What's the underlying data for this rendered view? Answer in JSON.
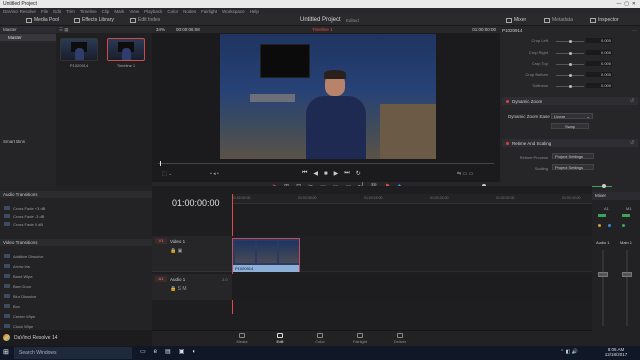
{
  "window": {
    "title": "Untitled Project"
  },
  "menu": [
    "DaVinci Resolve",
    "File",
    "Edit",
    "Trim",
    "Timeline",
    "Clip",
    "Mark",
    "View",
    "Playback",
    "Color",
    "Nodes",
    "Fairlight",
    "Workspace",
    "Help"
  ],
  "toolbar": {
    "media_pool": "Media Pool",
    "effects_library": "Effects Library",
    "edit_index": "Edit Index",
    "project_title": "Untitled Project",
    "project_state": "Edited",
    "mixer": "Mixer",
    "metadata": "Metadata",
    "inspector": "Inspector"
  },
  "bins": {
    "header": "Master",
    "items": [
      "Master"
    ],
    "smart_bins": "Smart Bins"
  },
  "media_pool": {
    "clips": [
      {
        "name": "P1020914"
      },
      {
        "name": "Timeline 1"
      }
    ]
  },
  "viewer": {
    "zoom": "34%",
    "source_tc": "00:00:06:08",
    "timeline_name": "Timeline 1",
    "record_tc": "01:00:00:00"
  },
  "inspector": {
    "clip_name": "P1020914",
    "crop": [
      {
        "label": "Crop Left",
        "value": "0.000"
      },
      {
        "label": "Crop Right",
        "value": "0.000"
      },
      {
        "label": "Crop Top",
        "value": "0.000"
      },
      {
        "label": "Crop Bottom",
        "value": "0.000"
      },
      {
        "label": "Softness",
        "value": "0.000"
      }
    ],
    "dynamic_zoom": {
      "title": "Dynamic Zoom",
      "ease_label": "Dynamic Zoom Ease",
      "ease_value": "Linear",
      "swap": "Swap"
    },
    "retime": {
      "title": "Retime And Scaling",
      "retime_process_label": "Retime Process",
      "retime_process_value": "Project Settings",
      "scaling_label": "Scaling",
      "scaling_value": "Project Settings"
    }
  },
  "effects": {
    "audio_header": "Audio Transitions",
    "audio_items": [
      "Cross Fade +3 dB",
      "Cross Fade -3 dB",
      "Cross Fade 0 dB"
    ],
    "video_header": "Video Transitions",
    "video_items": [
      "Additive Dissolve",
      "Arrow Iris",
      "Band Wipe",
      "Barn Door",
      "Blur Dissolve",
      "Box",
      "Center Wipe",
      "Clock Wipe"
    ]
  },
  "timeline": {
    "timecode": "01:00:00:00",
    "ruler": [
      "01:00:00:00",
      "01:00:08:00",
      "01:00:16:00",
      "01:00:24:00",
      "01:00:32:00",
      "01:00:40:00",
      "01:00:48:00"
    ],
    "video_track": {
      "id": "V1",
      "name": "Video 1"
    },
    "audio_track": {
      "id": "A1",
      "name": "Audio 1",
      "format": "2.0"
    },
    "clip_name": "P1020914"
  },
  "mixer": {
    "title": "Mixer",
    "a1": "A1",
    "m1": "M1",
    "audio1": "Audio 1",
    "main1": "Main 1"
  },
  "pages": [
    {
      "label": "Media",
      "active": false
    },
    {
      "label": "Edit",
      "active": true
    },
    {
      "label": "Color",
      "active": false
    },
    {
      "label": "Fairlight",
      "active": false
    },
    {
      "label": "Deliver",
      "active": false
    }
  ],
  "taskbar": {
    "search": "Search Windows",
    "app": "DaVinci Resolve 14",
    "time": "8:05 AM",
    "date": "12/18/2017"
  }
}
